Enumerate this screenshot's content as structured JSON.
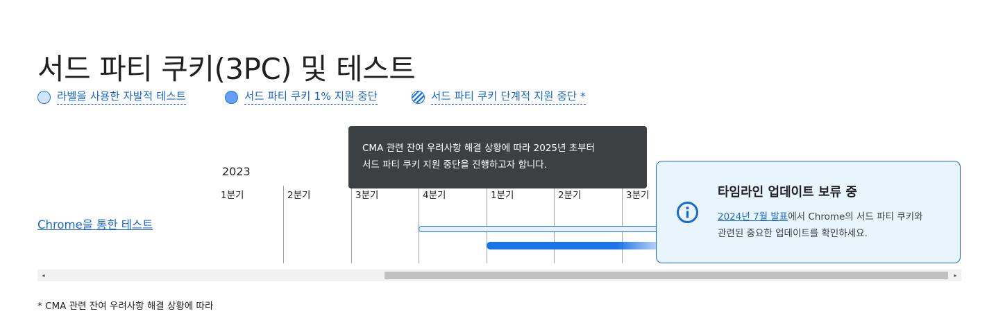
{
  "page": {
    "title": "서드 파티 쿠키(3PC) 및 테스트"
  },
  "legend": [
    {
      "label": "라벨을 사용한 자발적 테스트",
      "swatch": "light"
    },
    {
      "label": "서드 파티 쿠키 1% 지원 중단",
      "swatch": "solid"
    },
    {
      "label": "서드 파티 쿠키 단계적 지원 중단 *",
      "swatch": "hatched"
    }
  ],
  "timeline": {
    "year": "2023",
    "quarters": [
      "1분기",
      "2분기",
      "3분기",
      "4분기",
      "1분기",
      "2분기",
      "3분기"
    ],
    "row_label": "Chrome을 통한 테스트"
  },
  "tooltip": {
    "line1": "CMA 관련 잔여 우려사항 해결 상황에 따라 2025년 초부터",
    "line2": "서드 파티 쿠키 지원 중단을 진행하고자 합니다."
  },
  "notice": {
    "icon": "info-icon",
    "title": "타임라인 업데이트 보류 중",
    "link_text": "2024년 7월 발표",
    "body_part1": "에서 Chrome의 서드 파티 쿠키와",
    "body_part2": "관련된 중요한 업데이트를 확인하세요."
  },
  "scrollbar": {
    "left_arrow": "◂",
    "right_arrow": "▸"
  },
  "footnote": "* CMA 관련 잔여 우려사항 해결 상황에 따라",
  "colors": {
    "accent": "#1a73e8",
    "link": "#1967d2",
    "tooltip_bg": "#3c4043",
    "notice_bg": "#e8f5fd"
  }
}
